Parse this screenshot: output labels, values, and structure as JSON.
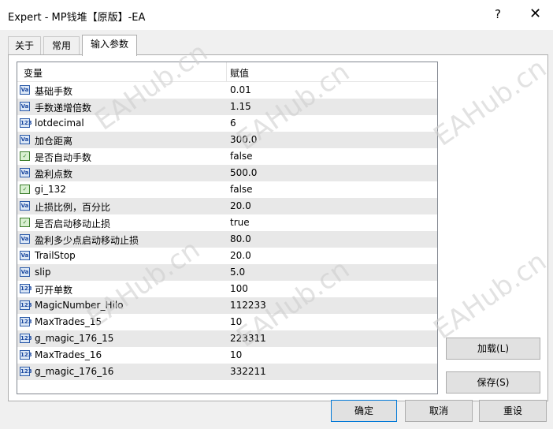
{
  "window": {
    "title": "Expert - MP钱堆【原版】-EA",
    "help": "?",
    "close": "✕"
  },
  "tabs": [
    "关于",
    "常用",
    "输入参数"
  ],
  "table": {
    "headers": [
      "变量",
      "赋值"
    ],
    "rows": [
      {
        "type": "num",
        "name": "基础手数",
        "value": "0.01"
      },
      {
        "type": "num",
        "name": "手数递增倍数",
        "value": "1.15"
      },
      {
        "type": "int",
        "name": "lotdecimal",
        "value": "6"
      },
      {
        "type": "num",
        "name": "加仓距离",
        "value": "300.0"
      },
      {
        "type": "bool",
        "name": "是否自动手数",
        "value": "false"
      },
      {
        "type": "num",
        "name": "盈利点数",
        "value": "500.0"
      },
      {
        "type": "bool",
        "name": "gi_132",
        "value": "false"
      },
      {
        "type": "num",
        "name": "止损比例，百分比",
        "value": "20.0"
      },
      {
        "type": "bool",
        "name": "是否启动移动止损",
        "value": "true"
      },
      {
        "type": "num",
        "name": "盈利多少点启动移动止损",
        "value": "80.0"
      },
      {
        "type": "num",
        "name": "TrailStop",
        "value": "20.0"
      },
      {
        "type": "num",
        "name": "slip",
        "value": "5.0"
      },
      {
        "type": "int",
        "name": "可开单数",
        "value": "100"
      },
      {
        "type": "int",
        "name": "MagicNumber_Hilo",
        "value": "112233"
      },
      {
        "type": "int",
        "name": "MaxTrades_15",
        "value": "10"
      },
      {
        "type": "int",
        "name": "g_magic_176_15",
        "value": "223311"
      },
      {
        "type": "int",
        "name": "MaxTrades_16",
        "value": "10"
      },
      {
        "type": "int",
        "name": "g_magic_176_16",
        "value": "332211"
      }
    ]
  },
  "side_buttons": {
    "load": "加载(L)",
    "save": "保存(S)"
  },
  "bottom_buttons": {
    "ok": "确定",
    "cancel": "取消",
    "reset": "重设"
  },
  "watermark": "EAHub.cn"
}
